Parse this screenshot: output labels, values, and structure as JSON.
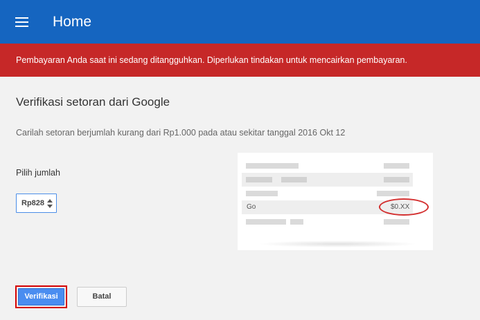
{
  "header": {
    "title": "Home",
    "menu_icon": "hamburger-menu-icon",
    "color": "#1565c0"
  },
  "alert": {
    "text": "Pembayaran Anda saat ini sedang ditangguhkan. Diperlukan tindakan untuk mencairkan pembayaran.",
    "color": "#c62828"
  },
  "main": {
    "title": "Verifikasi setoran dari Google",
    "instruction": "Carilah setoran berjumlah kurang dari Rp1.000 pada atau sekitar tanggal 2016 Okt 12",
    "amount_label": "Pilih jumlah",
    "amount_selected": "Rp828"
  },
  "statement": {
    "description": "Go",
    "amount": "$0.XX",
    "highlight_color": "#d32f2f"
  },
  "actions": {
    "verify_label": "Verifikasi",
    "cancel_label": "Batal",
    "accent": "#4a8df0"
  }
}
